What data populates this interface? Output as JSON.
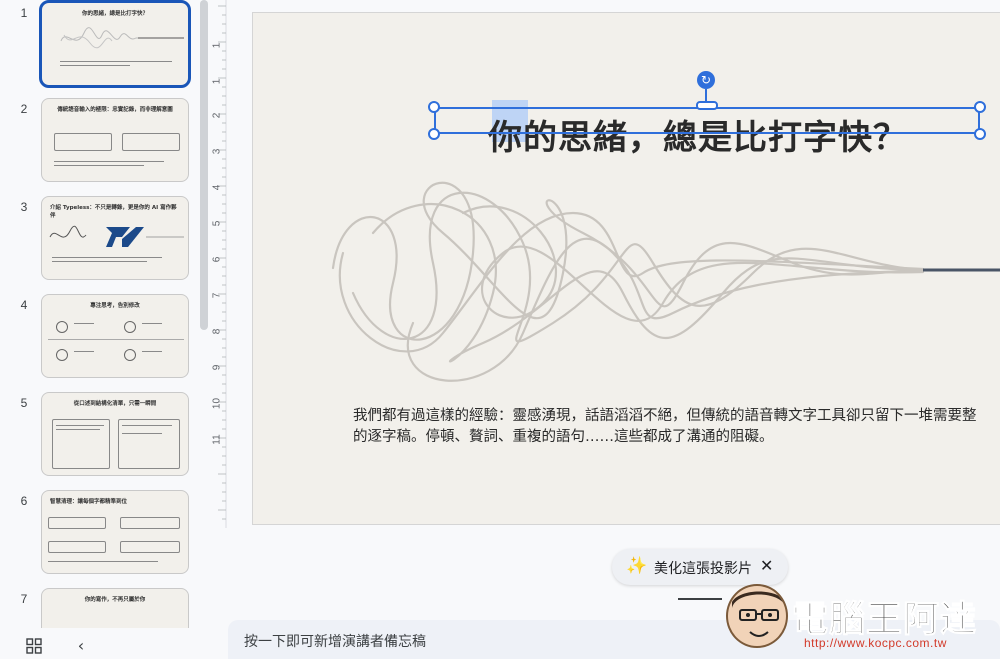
{
  "filmstrip": {
    "slides": [
      {
        "num": "1",
        "title": "你的思緒，總是比打字快？",
        "selected": true
      },
      {
        "num": "2",
        "title": "傳統語音輸入的極限：忠實記錄，而非理解意圖",
        "selected": false
      },
      {
        "num": "3",
        "title": "介紹 Typeless：不只是轉錄，更是你的 AI 寫作夥伴",
        "selected": false
      },
      {
        "num": "4",
        "title": "專注思考，告別修改",
        "selected": false
      },
      {
        "num": "5",
        "title": "從口述到結構化清單，只需一瞬間",
        "selected": false
      },
      {
        "num": "6",
        "title": "智慧清理：讓每個字都精準到位",
        "selected": false
      },
      {
        "num": "7",
        "title": "你的寫作，不再只屬於你",
        "selected": false
      }
    ]
  },
  "ruler": {
    "vertical_labels": [
      "1",
      "1",
      "2",
      "3",
      "4",
      "5",
      "6",
      "7",
      "8",
      "9",
      "10",
      "11"
    ]
  },
  "slide": {
    "title_before": "你的思緒，總是",
    "title_selected": "比",
    "title_after": "打字快？",
    "body_line1": "我們都有過這樣的經驗：靈感湧現，話語滔滔不絕，但傳統的語音轉文字工具卻只留下一堆需要整",
    "body_line2": "的逐字稿。停頓、贅詞、重複的語句……這些都成了溝通的阻礙。"
  },
  "beautify": {
    "label": "美化這張投影片",
    "icon": "sparkle-wand-icon",
    "close_icon": "close-icon"
  },
  "notes": {
    "placeholder": "按一下即可新增演講者備忘稿"
  },
  "controls": {
    "grid_icon": "grid-view-icon",
    "collapse_label": "‹"
  },
  "watermark": {
    "text": "電腦王阿達",
    "url": "http://www.kocpc.com.tw"
  },
  "colors": {
    "selection": "#2f6fdb",
    "slide_bg": "#f2f0eb",
    "thumb_selected_border": "#1a56b8",
    "notes_bg": "#eef1f7"
  }
}
